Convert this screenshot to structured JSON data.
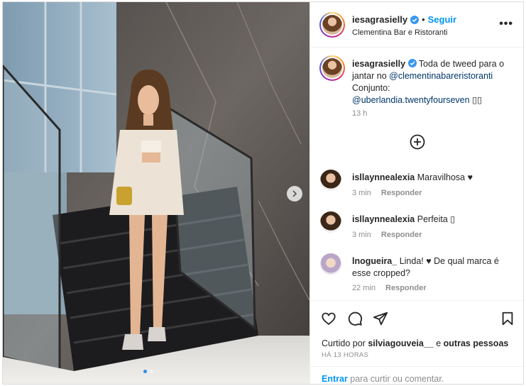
{
  "post": {
    "username": "iesagrasielly",
    "follow_label": "Seguir",
    "separator": "•",
    "location": "Clementina Bar e Ristoranti",
    "more_label": "•••"
  },
  "caption": {
    "text_1": "Toda de tweed para o jantar no ",
    "mention_1": "@clementinabareristoranti",
    "text_2": "Conjunto:",
    "mention_2": "@uberlandia.twentyfourseven",
    "trailing": "▯▯",
    "time": "13 h"
  },
  "comments": [
    {
      "username": "isllaynnealexia",
      "text": "Maravilhosa ♥",
      "time": "3 min",
      "reply_label": "Responder"
    },
    {
      "username": "isllaynnealexia",
      "text": "Perfeita ▯",
      "time": "3 min",
      "reply_label": "Responder"
    },
    {
      "username": "lnogueira_",
      "text": "Linda! ♥ De qual marca é esse cropped?",
      "time": "22 min",
      "reply_label": "Responder"
    }
  ],
  "actions": {
    "liked_prefix": "Curtido por ",
    "liked_user": "silviagouveia__",
    "liked_suffix": " e ",
    "liked_others": "outras pessoas",
    "ago": "HÁ 13 HORAS"
  },
  "login": {
    "link": "Entrar",
    "text": " para curtir ou comentar."
  },
  "carousel": {
    "current": 1,
    "total": 2
  },
  "icons": [
    "verified-icon",
    "more-options-icon",
    "load-more-comments-icon",
    "heart-icon",
    "comment-icon",
    "share-icon",
    "save-icon",
    "next-photo-icon"
  ],
  "colors": {
    "accent": "#0095f6",
    "mention": "#00376b",
    "muted": "#8e8e8e",
    "verified": "#3897f0"
  }
}
